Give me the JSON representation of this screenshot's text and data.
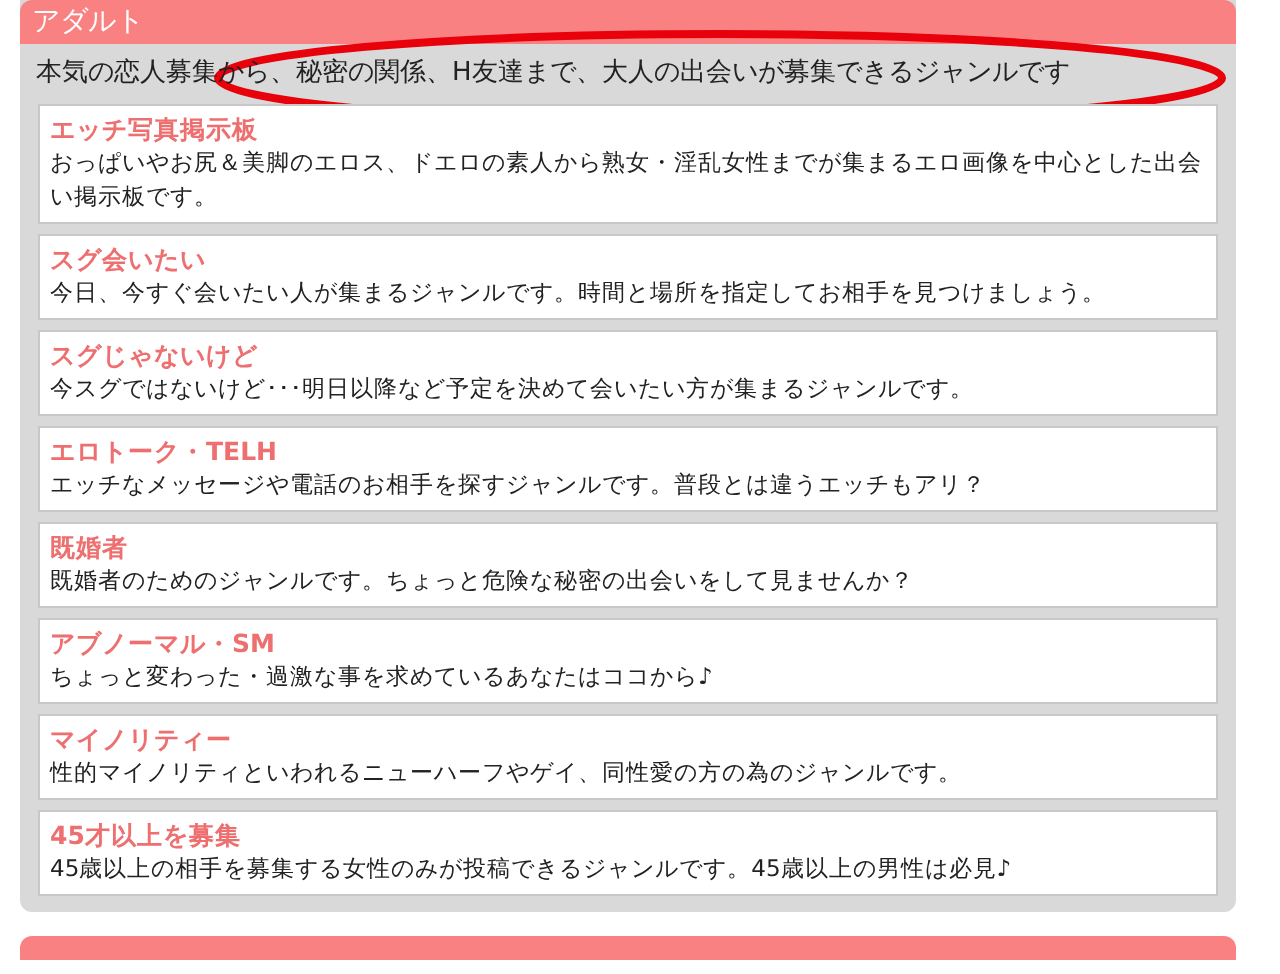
{
  "section": {
    "title": "アダルト",
    "intro": "本気の恋人募集から、秘密の関係、H友達まで、大人の出会いが募集できるジャンルです",
    "highlighted": true
  },
  "genres": [
    {
      "title": "エッチ写真掲示板",
      "description": "おっぱいやお尻＆美脚のエロス、ドエロの素人から熟女・淫乱女性までが集まるエロ画像を中心とした出会い掲示板です。"
    },
    {
      "title": "スグ会いたい",
      "description": "今日、今すぐ会いたい人が集まるジャンルです。時間と場所を指定してお相手を見つけましょう。"
    },
    {
      "title": "スグじゃないけど",
      "description": "今スグではないけど･･･明日以降など予定を決めて会いたい方が集まるジャンルです。"
    },
    {
      "title": "エロトーク・TELH",
      "description": "エッチなメッセージや電話のお相手を探すジャンルです。普段とは違うエッチもアリ？"
    },
    {
      "title": "既婚者",
      "description": "既婚者のためのジャンルです。ちょっと危険な秘密の出会いをして見ませんか？"
    },
    {
      "title": "アブノーマル・SM",
      "description": "ちょっと変わった・過激な事を求めているあなたはココから♪"
    },
    {
      "title": "マイノリティー",
      "description": "性的マイノリティといわれるニューハーフやゲイ、同性愛の方の為のジャンルです。"
    },
    {
      "title": "45才以上を募集",
      "description": "45歳以上の相手を募集する女性のみが投稿できるジャンルです。45歳以上の男性は必見♪"
    }
  ]
}
